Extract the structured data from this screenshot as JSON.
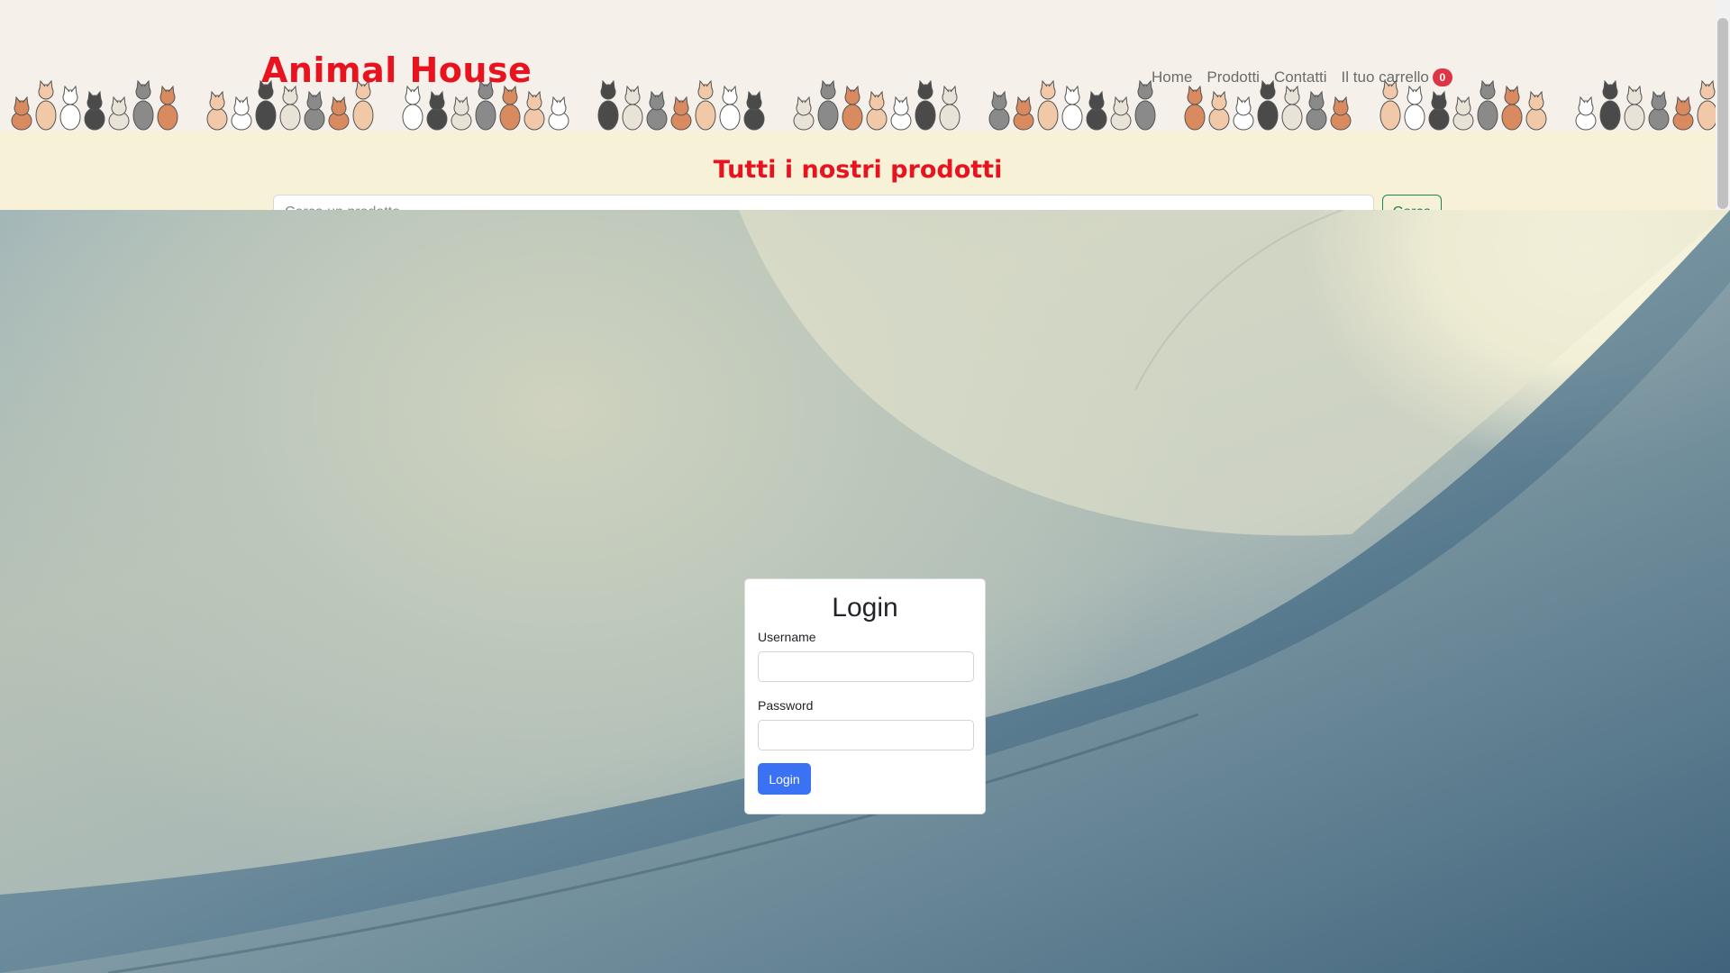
{
  "header": {
    "brand": "Animal House",
    "nav": [
      {
        "label": "Home"
      },
      {
        "label": "Prodotti"
      },
      {
        "label": "Contatti"
      },
      {
        "label": "Il tuo carrello"
      }
    ],
    "cart_count": "0",
    "brand_color": "#e8131f"
  },
  "products": {
    "title": "Tutti i nostri prodotti",
    "search_placeholder": "Cerca un prodotto",
    "search_button": "Cerca"
  },
  "login": {
    "title": "Login",
    "username_label": "Username",
    "username_value": "",
    "password_label": "Password",
    "password_value": "",
    "submit_label": "Login",
    "accent_color": "#3b71f3"
  },
  "icons": {
    "header_decoration": "cat-group-icon"
  }
}
